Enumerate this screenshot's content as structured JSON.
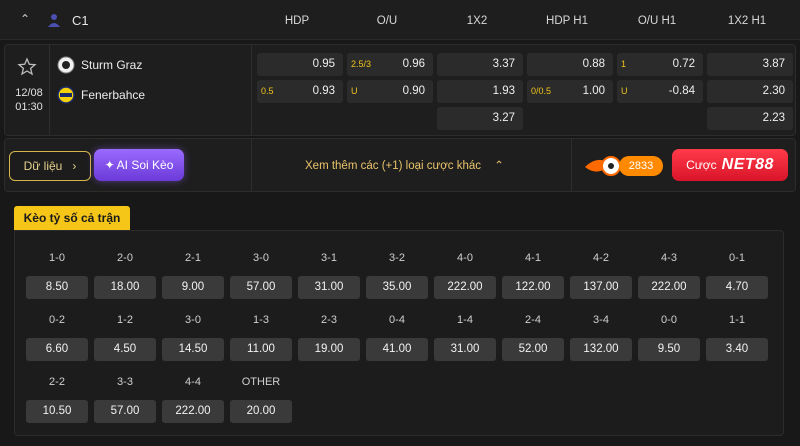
{
  "header": {
    "league": "C1",
    "columns": [
      "HDP",
      "O/U",
      "1X2",
      "HDP H1",
      "O/U H1",
      "1X2 H1"
    ]
  },
  "match": {
    "date": "12/08",
    "time": "01:30",
    "home": "Sturm Graz",
    "away": "Fenerbahce",
    "odds": {
      "hdp": {
        "home": "0.95",
        "away_line": "0.5",
        "away": "0.93"
      },
      "ou": {
        "line": "2.5/3",
        "over": "0.96",
        "under_label": "U",
        "under": "0.90"
      },
      "x12": {
        "home": "3.37",
        "away": "1.93",
        "draw": "3.27"
      },
      "hdp_h1": {
        "home": "0.88",
        "away_line": "0/0.5",
        "away": "1.00"
      },
      "ou_h1": {
        "line": "1",
        "over": "0.72",
        "under_label": "U",
        "under": "-0.84"
      },
      "x12_h1": {
        "home": "3.87",
        "away": "2.30",
        "draw": "2.23"
      }
    }
  },
  "actions": {
    "data_label": "Dữ liệu",
    "ai_label": "AI Soi Kèo",
    "more_label": "Xem thêm các (+1) loại cược khác",
    "promo_number": "2833",
    "promo_bet_prefix": "Cược",
    "promo_bet_brand": "NET88"
  },
  "correct_score": {
    "tab_label": "Kèo tỷ số cả trận",
    "rows": [
      [
        {
          "score": "1-0",
          "odd": "8.50"
        },
        {
          "score": "2-0",
          "odd": "18.00"
        },
        {
          "score": "2-1",
          "odd": "9.00"
        },
        {
          "score": "3-0",
          "odd": "57.00"
        },
        {
          "score": "3-1",
          "odd": "31.00"
        },
        {
          "score": "3-2",
          "odd": "35.00"
        },
        {
          "score": "4-0",
          "odd": "222.00"
        },
        {
          "score": "4-1",
          "odd": "122.00"
        },
        {
          "score": "4-2",
          "odd": "137.00"
        },
        {
          "score": "4-3",
          "odd": "222.00"
        },
        {
          "score": "0-1",
          "odd": "4.70"
        }
      ],
      [
        {
          "score": "0-2",
          "odd": "6.60"
        },
        {
          "score": "1-2",
          "odd": "4.50"
        },
        {
          "score": "3-0",
          "odd": "14.50"
        },
        {
          "score": "1-3",
          "odd": "11.00"
        },
        {
          "score": "2-3",
          "odd": "19.00"
        },
        {
          "score": "0-4",
          "odd": "41.00"
        },
        {
          "score": "1-4",
          "odd": "31.00"
        },
        {
          "score": "2-4",
          "odd": "52.00"
        },
        {
          "score": "3-4",
          "odd": "132.00"
        },
        {
          "score": "0-0",
          "odd": "9.50"
        },
        {
          "score": "1-1",
          "odd": "3.40"
        }
      ],
      [
        {
          "score": "2-2",
          "odd": "10.50"
        },
        {
          "score": "3-3",
          "odd": "57.00"
        },
        {
          "score": "4-4",
          "odd": "222.00"
        },
        {
          "score": "OTHER",
          "odd": "20.00"
        }
      ]
    ]
  },
  "colors": {
    "accent": "#f5c518",
    "ai": "#8a5cf6",
    "promo": "#e8192c"
  }
}
